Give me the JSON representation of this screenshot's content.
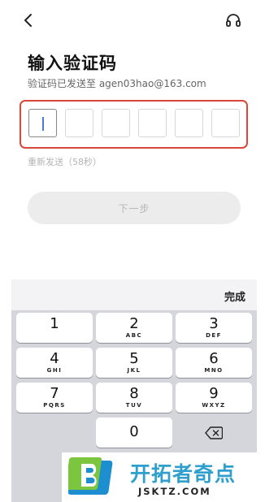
{
  "header": {
    "back_icon": "chevron-left-icon",
    "support_icon": "headset-icon"
  },
  "page": {
    "title": "输入验证码",
    "subtitle": "验证码已发送至 agen03hao@163.com",
    "resend": "重新发送（58秒）",
    "next_label": "下一步"
  },
  "code_input": {
    "length": 6,
    "digits": [
      "",
      "",
      "",
      "",
      "",
      ""
    ],
    "active_index": 0,
    "highlight_color": "#d9473a"
  },
  "keyboard": {
    "done_label": "完成",
    "keys": [
      {
        "num": "1",
        "letters": ""
      },
      {
        "num": "2",
        "letters": "ABC"
      },
      {
        "num": "3",
        "letters": "DEF"
      },
      {
        "num": "4",
        "letters": "GHI"
      },
      {
        "num": "5",
        "letters": "JKL"
      },
      {
        "num": "6",
        "letters": "MNO"
      },
      {
        "num": "7",
        "letters": "PQRS"
      },
      {
        "num": "8",
        "letters": "TUV"
      },
      {
        "num": "9",
        "letters": "WXYZ"
      },
      {
        "num": "0",
        "letters": ""
      }
    ],
    "backspace_icon": "backspace-icon"
  },
  "watermark": {
    "brand": "开拓者奇点",
    "domain": "JSKTZ.COM",
    "brand_color": "#2f9fce"
  }
}
